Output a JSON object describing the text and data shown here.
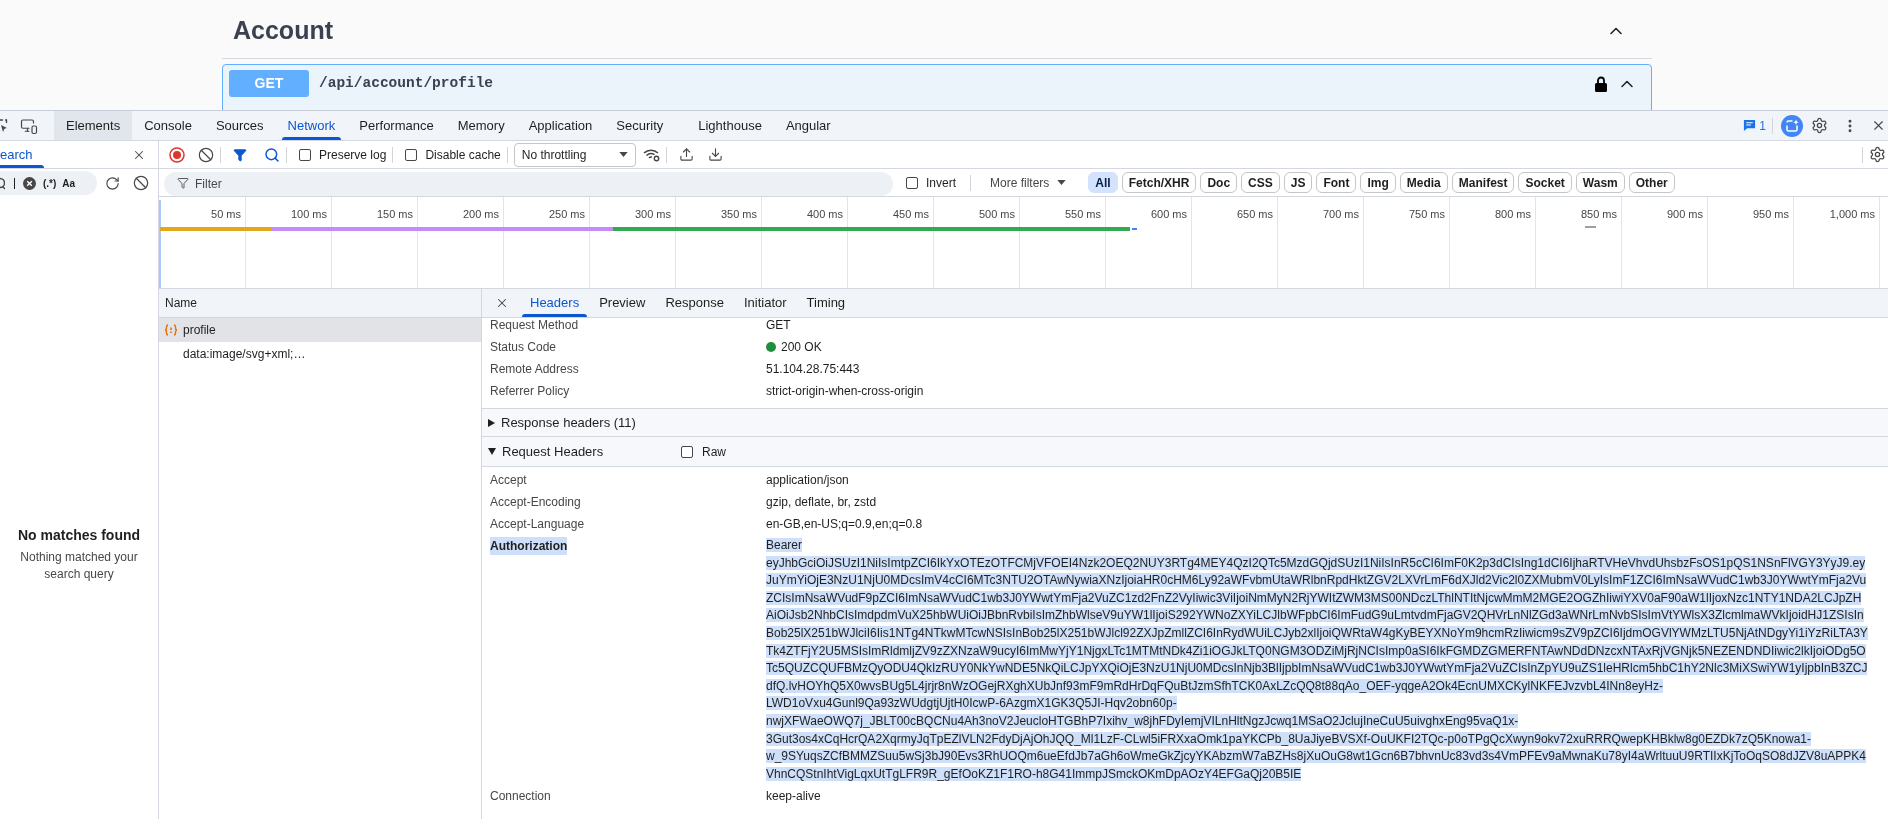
{
  "page": {
    "heading": "Account",
    "operation": {
      "method": "GET",
      "path": "/api/account/profile",
      "locked": true
    }
  },
  "devtools": {
    "tabs": [
      {
        "label": "Elements",
        "selected": false,
        "hovered": true
      },
      {
        "label": "Console",
        "selected": false,
        "hovered": false
      },
      {
        "label": "Sources",
        "selected": false,
        "hovered": false
      },
      {
        "label": "Network",
        "selected": true,
        "hovered": false
      },
      {
        "label": "Performance",
        "selected": false,
        "hovered": false
      },
      {
        "label": "Memory",
        "selected": false,
        "hovered": false
      },
      {
        "label": "Application",
        "selected": false,
        "hovered": false
      },
      {
        "label": "Security",
        "selected": false,
        "hovered": false
      },
      {
        "label": "Lighthouse",
        "selected": false,
        "hovered": false
      },
      {
        "label": "Angular",
        "selected": false,
        "hovered": false
      }
    ],
    "issues_count": "1",
    "drawer": {
      "tab": "earch",
      "regex_toggle": "(.*)",
      "case_toggle": "Aa",
      "status": "No matches found",
      "message": "Nothing matched your search query"
    },
    "network": {
      "toolbar": {
        "recording": true,
        "options": [
          {
            "label": "Preserve log",
            "checked": false
          },
          {
            "label": "Disable cache",
            "checked": false
          }
        ],
        "throttling": "No throttling"
      },
      "filter": {
        "placeholder": "Filter",
        "invert": {
          "label": "Invert",
          "checked": false
        },
        "more_filters": "More filters",
        "types": [
          {
            "label": "All",
            "selected": true
          },
          {
            "label": "Fetch/XHR",
            "selected": false
          },
          {
            "label": "Doc",
            "selected": false
          },
          {
            "label": "CSS",
            "selected": false
          },
          {
            "label": "JS",
            "selected": false
          },
          {
            "label": "Font",
            "selected": false
          },
          {
            "label": "Img",
            "selected": false
          },
          {
            "label": "Media",
            "selected": false
          },
          {
            "label": "Manifest",
            "selected": false
          },
          {
            "label": "Socket",
            "selected": false
          },
          {
            "label": "Wasm",
            "selected": false
          },
          {
            "label": "Other",
            "selected": false
          }
        ]
      },
      "timeline": {
        "ticks": [
          "50 ms",
          "100 ms",
          "150 ms",
          "200 ms",
          "250 ms",
          "300 ms",
          "350 ms",
          "400 ms",
          "450 ms",
          "500 ms",
          "550 ms",
          "600 ms",
          "650 ms",
          "700 ms",
          "750 ms",
          "800 ms",
          "850 ms",
          "900 ms",
          "950 ms",
          "1,000 ms"
        ]
      },
      "requests": {
        "column": "Name",
        "rows": [
          {
            "name": "profile",
            "kind": "fetch",
            "selected": true
          },
          {
            "name": "data:image/svg+xml;…",
            "kind": "image",
            "selected": false
          }
        ]
      },
      "details": {
        "tabs": [
          {
            "label": "Headers",
            "selected": true
          },
          {
            "label": "Preview",
            "selected": false
          },
          {
            "label": "Response",
            "selected": false
          },
          {
            "label": "Initiator",
            "selected": false
          },
          {
            "label": "Timing",
            "selected": false
          }
        ],
        "general": [
          {
            "name": "Request Method",
            "value": "GET"
          },
          {
            "name": "Status Code",
            "value": "200 OK",
            "color": "#1e8e3e"
          },
          {
            "name": "Remote Address",
            "value": "51.104.28.75:443"
          },
          {
            "name": "Referrer Policy",
            "value": "strict-origin-when-cross-origin"
          }
        ],
        "response_headers": {
          "title": "Response headers (11)",
          "expanded": false
        },
        "request_headers": {
          "title": "Request Headers",
          "expanded": true,
          "raw": {
            "label": "Raw",
            "checked": false
          },
          "rows": [
            {
              "name": "Accept",
              "value": "application/json",
              "highlighted": false
            },
            {
              "name": "Accept-Encoding",
              "value": "gzip, deflate, br, zstd",
              "highlighted": false
            },
            {
              "name": "Accept-Language",
              "value": "en-GB,en-US;q=0.9,en;q=0.8",
              "highlighted": false
            },
            {
              "name": "Authorization",
              "value": "Bearer eyJhbGciOiJSUzI1NiIsImtpZCI6IkYxOTEzOTFCMjVFOEI4Nzk2OEQ2NUY3RTg4MEY4QzI2QTc5MzdGQjdSUzI1NiIsInR5cCI6ImF0K2p3dCIsIng1dCI6IjhaRTVHeVhvdUhsbzFsOS1pQS1NSnFlVGY3YyJ9.eyJuYmYiOjE3NzU1NjU0MDcsImV4cCI6MTc3NTU2OTAwNywiaXNzIjoiaHR0cHM6Ly92aWFvbmUtaWRlbnRpdHktZGV2LXVrLmF6dXJld2Vic2l0ZXMubmV0LyIsImF1ZCI6ImNsaWVudC1wb3J0YWwtYmFja2VuZCIsImNsaWVudF9pZCI6ImNsaWVudC1wb3J0YWwtYmFja2VuZC1zd2FnZ2VyIiwic3ViIjoiNmMyN2RjYWItZWM3MS00NDczLThlNTItNjcwMmM2MGE2OGZhIiwiYXV0aF90aW1lIjoxNzc1NTY1NDA2LCJpZHAiOiJsb2NhbCIsImdpdmVuX25hbWUiOiJBbnRvbiIsImZhbWlseV9uYW1lIjoiS292YWNoZXYiLCJlbWFpbCI6ImFudG9uLmtvdmFjaGV2QHVrLnNlZGd3aWNrLmNvbSIsImVtYWlsX3ZlcmlmaWVkIjoidHJ1ZSIsInBob25lX251bWJlciI6Iis1NTg4NTkwMTcwNSIsInBob25lX251bWJlcl92ZXJpZmllZCI6InRydWUiLCJyb2xlIjoiQWRtaW4gKyBEYXNoYm9hcmRzIiwicm9sZV9pZCI6IjdmOGVlYWMzLTU5NjAtNDgyYi1iYzRiLTA3YTk4ZTFjY2U5MSIsImRldmljZV9zZXNzaW9ucyI6ImMwYjY1NjgxLTc1MTMtNDk4Zi1iOGJkLTQ0NGM3ODZiMjRjNCIsImp0aSI6IkFGMDZGMERFNTAwNDdDNzcxNTAxRjVGNjk5NEZENDNDIiwic2lkIjoiODg5OTc5QUZCQUFBMzQyODU4QkIzRUY0NkYwNDE5NkQiLCJpYXQiOjE3NzU1NjU0MDcsInNjb3BlIjpbImNsaWVudC1wb3J0YWwtYmFja2VuZCIsInZpYU9uZS1leHRlcm5hbC1hY2Nlc3MiXSwiYW1yIjpbInB3ZCJdfQ.lvHOYhQ5X0wvsBUg5L4jrjr8nWzOGejRXghXUbJnf93mF9mRdHrDqFQuBtJzmSfhTCK0AxLZcQQ8t88qAo_OEF-yqgeA2Ok4EcnUMXCKylNKFEJvzvbL4INn8eyHz-LWD1oVxu4Gunl9Qa93zWUdgtjUjtH0IcwP-6AzgmX1GK3Q5JI-Hqv2obn60p-nwjXFWaeOWQ7j_JBLT00cBQCNu4Ah3noV2JeucloHTGBhP7Ixihv_w8jhFDyIemjVILnHltNgzJcwq1MSaO2JclujIneCuU5uivghxEng95vaQ1x-3Gut3os4xCqHcrQA2XqrmyJqTpEZlVLN2FdyDjAjOhJQQ_Ml1LzF-CLwl5iFRXxaOmk1paYKCPb_8UaJiyeBVSXf-OuUKFI2TQc-p0oTPgQcXwyn9okv72xuRRRQwepKHBklw8g0EZDk7zQ5Knowa1-w_9SYuqsZCfBMMZSuu5wSj3bJ90Evs3RhUOQm6ueEfdJb7aGh6oWmeGkZjcyYKAbzmW7aBZHs8jXuOuG8wt1Gcn6B7bhvnUc83vd3s4VmPFEv9aMwnaKu78yI4aWrltuuU9RTIIxKjToOqSO8dJZV8uAPPK4VhnCQStnIhtVigLqxUtTgLFR9R_gEfOoKZ1F1RO-h8G41ImmpJSmckOKmDpAOzY4EFGaQj20B5IE",
              "highlighted": true
            },
            {
              "name": "Connection",
              "value": "keep-alive",
              "highlighted": false
            }
          ]
        }
      }
    }
  }
}
